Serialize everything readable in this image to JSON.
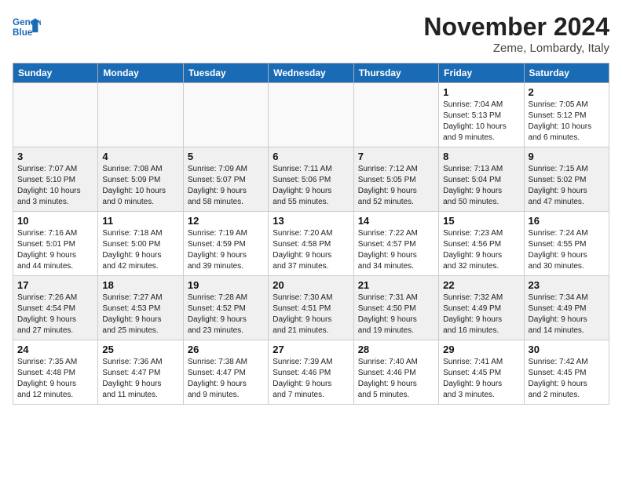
{
  "header": {
    "logo_line1": "General",
    "logo_line2": "Blue",
    "month_title": "November 2024",
    "location": "Zeme, Lombardy, Italy"
  },
  "weekdays": [
    "Sunday",
    "Monday",
    "Tuesday",
    "Wednesday",
    "Thursday",
    "Friday",
    "Saturday"
  ],
  "weeks": [
    [
      {
        "day": "",
        "info": ""
      },
      {
        "day": "",
        "info": ""
      },
      {
        "day": "",
        "info": ""
      },
      {
        "day": "",
        "info": ""
      },
      {
        "day": "",
        "info": ""
      },
      {
        "day": "1",
        "info": "Sunrise: 7:04 AM\nSunset: 5:13 PM\nDaylight: 10 hours\nand 9 minutes."
      },
      {
        "day": "2",
        "info": "Sunrise: 7:05 AM\nSunset: 5:12 PM\nDaylight: 10 hours\nand 6 minutes."
      }
    ],
    [
      {
        "day": "3",
        "info": "Sunrise: 7:07 AM\nSunset: 5:10 PM\nDaylight: 10 hours\nand 3 minutes."
      },
      {
        "day": "4",
        "info": "Sunrise: 7:08 AM\nSunset: 5:09 PM\nDaylight: 10 hours\nand 0 minutes."
      },
      {
        "day": "5",
        "info": "Sunrise: 7:09 AM\nSunset: 5:07 PM\nDaylight: 9 hours\nand 58 minutes."
      },
      {
        "day": "6",
        "info": "Sunrise: 7:11 AM\nSunset: 5:06 PM\nDaylight: 9 hours\nand 55 minutes."
      },
      {
        "day": "7",
        "info": "Sunrise: 7:12 AM\nSunset: 5:05 PM\nDaylight: 9 hours\nand 52 minutes."
      },
      {
        "day": "8",
        "info": "Sunrise: 7:13 AM\nSunset: 5:04 PM\nDaylight: 9 hours\nand 50 minutes."
      },
      {
        "day": "9",
        "info": "Sunrise: 7:15 AM\nSunset: 5:02 PM\nDaylight: 9 hours\nand 47 minutes."
      }
    ],
    [
      {
        "day": "10",
        "info": "Sunrise: 7:16 AM\nSunset: 5:01 PM\nDaylight: 9 hours\nand 44 minutes."
      },
      {
        "day": "11",
        "info": "Sunrise: 7:18 AM\nSunset: 5:00 PM\nDaylight: 9 hours\nand 42 minutes."
      },
      {
        "day": "12",
        "info": "Sunrise: 7:19 AM\nSunset: 4:59 PM\nDaylight: 9 hours\nand 39 minutes."
      },
      {
        "day": "13",
        "info": "Sunrise: 7:20 AM\nSunset: 4:58 PM\nDaylight: 9 hours\nand 37 minutes."
      },
      {
        "day": "14",
        "info": "Sunrise: 7:22 AM\nSunset: 4:57 PM\nDaylight: 9 hours\nand 34 minutes."
      },
      {
        "day": "15",
        "info": "Sunrise: 7:23 AM\nSunset: 4:56 PM\nDaylight: 9 hours\nand 32 minutes."
      },
      {
        "day": "16",
        "info": "Sunrise: 7:24 AM\nSunset: 4:55 PM\nDaylight: 9 hours\nand 30 minutes."
      }
    ],
    [
      {
        "day": "17",
        "info": "Sunrise: 7:26 AM\nSunset: 4:54 PM\nDaylight: 9 hours\nand 27 minutes."
      },
      {
        "day": "18",
        "info": "Sunrise: 7:27 AM\nSunset: 4:53 PM\nDaylight: 9 hours\nand 25 minutes."
      },
      {
        "day": "19",
        "info": "Sunrise: 7:28 AM\nSunset: 4:52 PM\nDaylight: 9 hours\nand 23 minutes."
      },
      {
        "day": "20",
        "info": "Sunrise: 7:30 AM\nSunset: 4:51 PM\nDaylight: 9 hours\nand 21 minutes."
      },
      {
        "day": "21",
        "info": "Sunrise: 7:31 AM\nSunset: 4:50 PM\nDaylight: 9 hours\nand 19 minutes."
      },
      {
        "day": "22",
        "info": "Sunrise: 7:32 AM\nSunset: 4:49 PM\nDaylight: 9 hours\nand 16 minutes."
      },
      {
        "day": "23",
        "info": "Sunrise: 7:34 AM\nSunset: 4:49 PM\nDaylight: 9 hours\nand 14 minutes."
      }
    ],
    [
      {
        "day": "24",
        "info": "Sunrise: 7:35 AM\nSunset: 4:48 PM\nDaylight: 9 hours\nand 12 minutes."
      },
      {
        "day": "25",
        "info": "Sunrise: 7:36 AM\nSunset: 4:47 PM\nDaylight: 9 hours\nand 11 minutes."
      },
      {
        "day": "26",
        "info": "Sunrise: 7:38 AM\nSunset: 4:47 PM\nDaylight: 9 hours\nand 9 minutes."
      },
      {
        "day": "27",
        "info": "Sunrise: 7:39 AM\nSunset: 4:46 PM\nDaylight: 9 hours\nand 7 minutes."
      },
      {
        "day": "28",
        "info": "Sunrise: 7:40 AM\nSunset: 4:46 PM\nDaylight: 9 hours\nand 5 minutes."
      },
      {
        "day": "29",
        "info": "Sunrise: 7:41 AM\nSunset: 4:45 PM\nDaylight: 9 hours\nand 3 minutes."
      },
      {
        "day": "30",
        "info": "Sunrise: 7:42 AM\nSunset: 4:45 PM\nDaylight: 9 hours\nand 2 minutes."
      }
    ]
  ]
}
